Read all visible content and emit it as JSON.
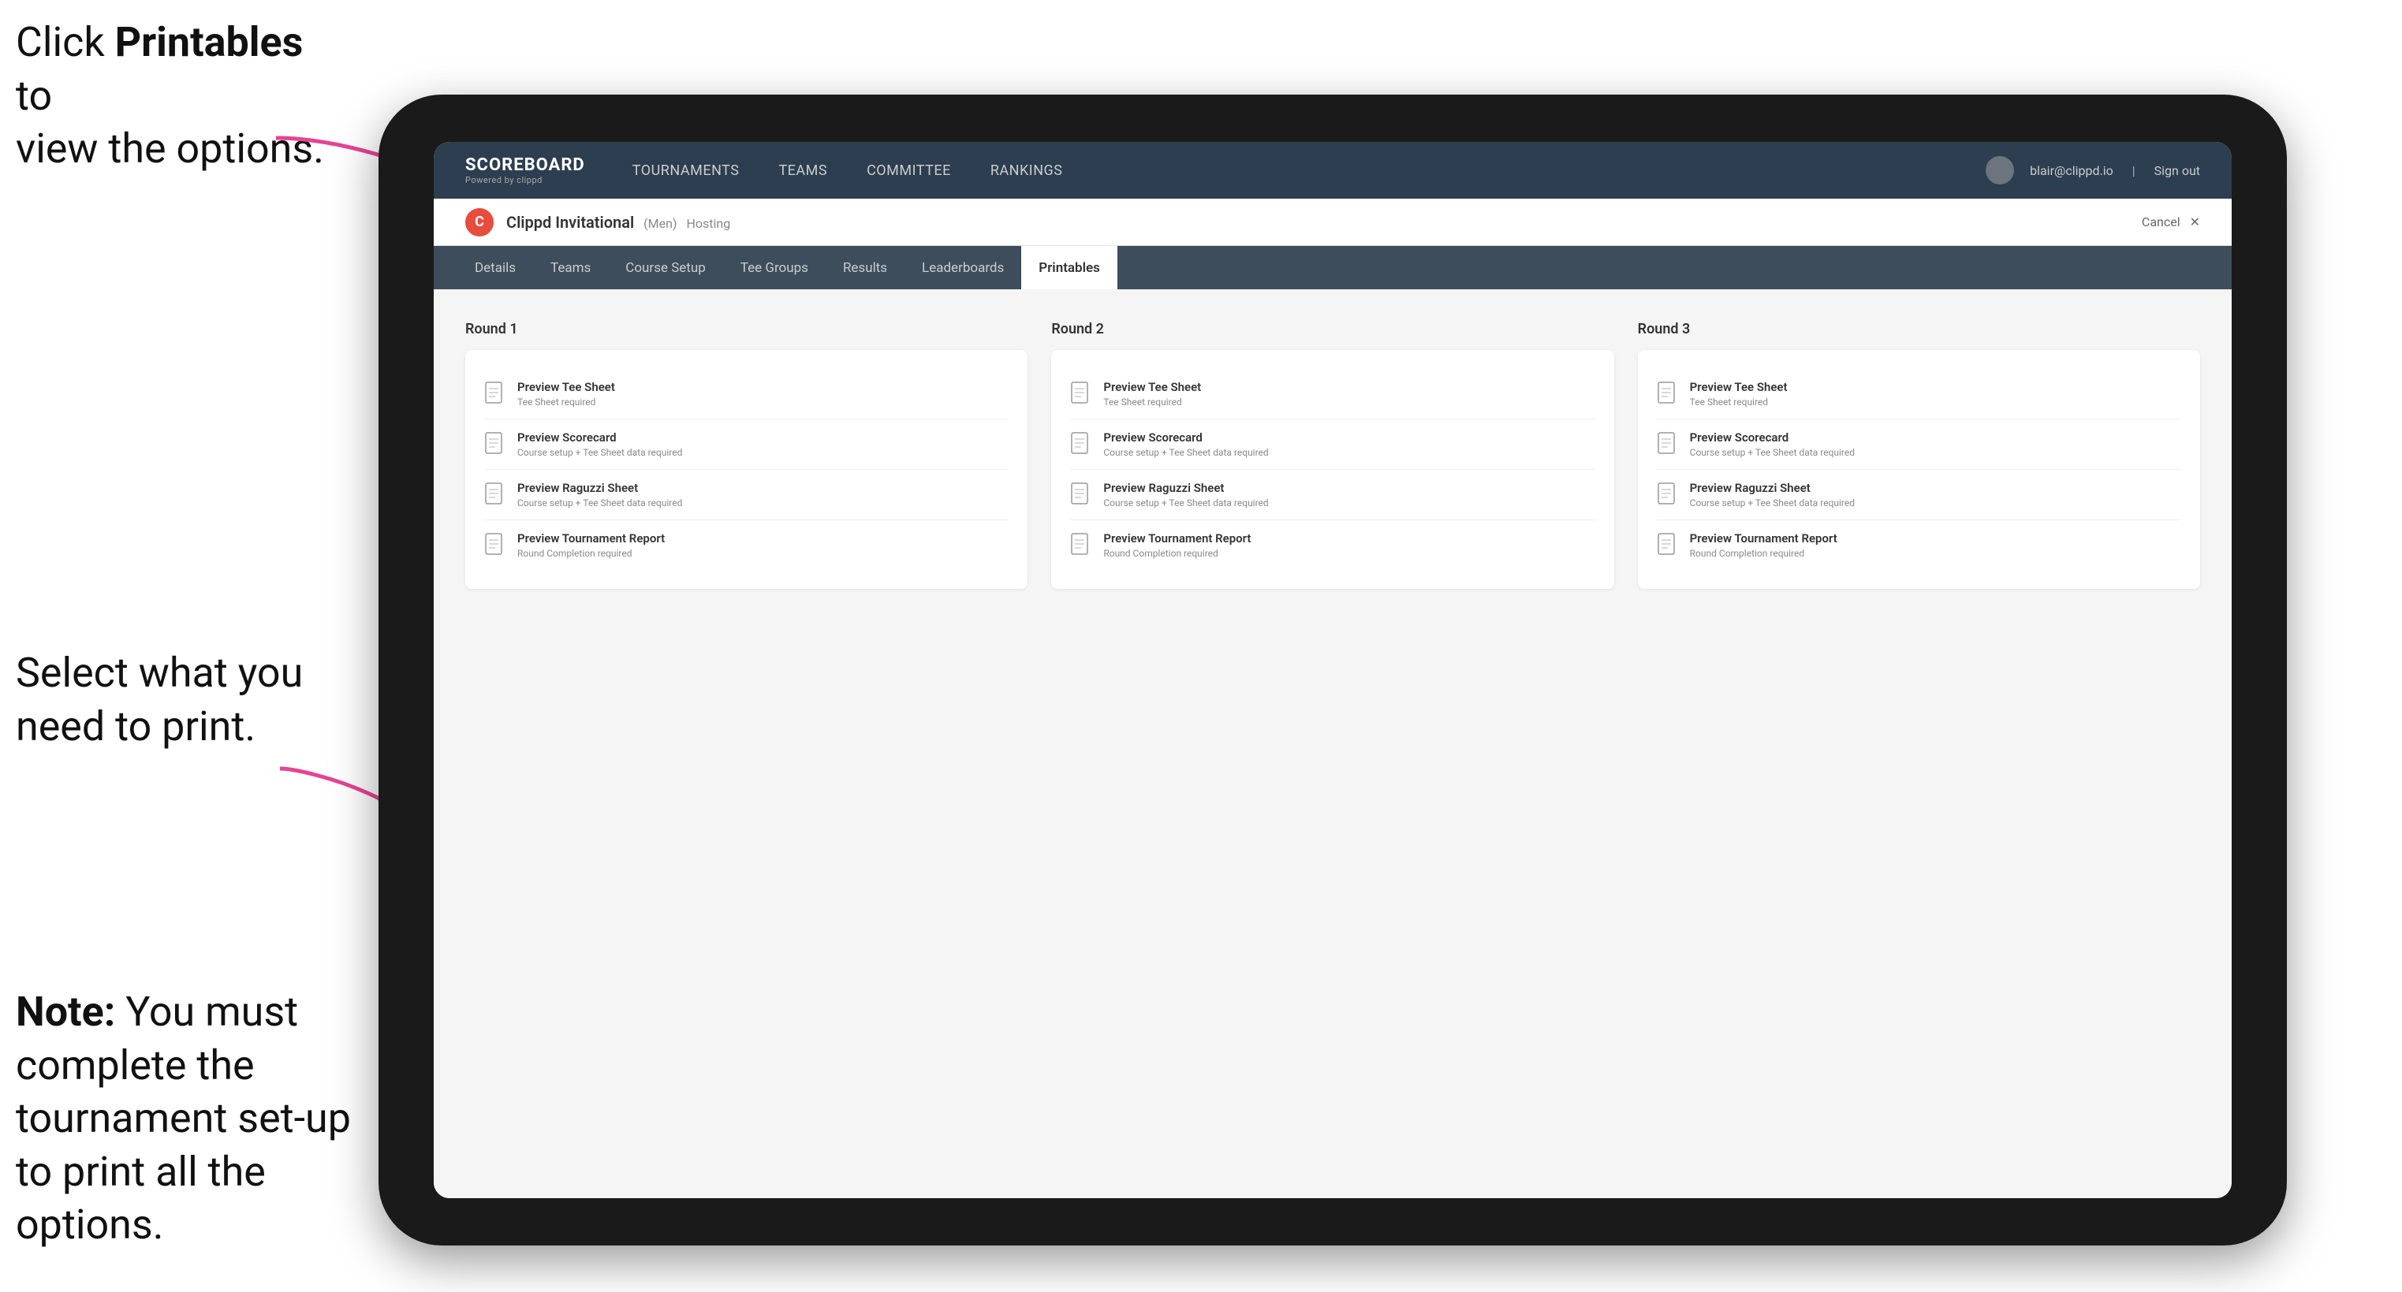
{
  "annotations": {
    "top": {
      "prefix": "Click ",
      "bold": "Printables",
      "suffix": " to\nview the options."
    },
    "middle": "Select what you\nneed to print.",
    "bottom": {
      "bold_prefix": "Note:",
      "suffix": " You must\ncomplete the\ntournament set-up\nto print all the options."
    }
  },
  "nav": {
    "logo_title": "SCOREBOARD",
    "logo_subtitle": "Powered by clippd",
    "links": [
      {
        "label": "TOURNAMENTS",
        "active": false
      },
      {
        "label": "TEAMS",
        "active": false
      },
      {
        "label": "COMMITTEE",
        "active": false
      },
      {
        "label": "RANKINGS",
        "active": false
      }
    ],
    "user_email": "blair@clippd.io",
    "sign_out": "Sign out"
  },
  "sub_header": {
    "logo_letter": "C",
    "tournament_name": "Clippd Invitational",
    "tournament_meta": "(Men)",
    "hosting": "Hosting",
    "cancel": "Cancel"
  },
  "tabs": [
    {
      "label": "Details",
      "active": false
    },
    {
      "label": "Teams",
      "active": false
    },
    {
      "label": "Course Setup",
      "active": false
    },
    {
      "label": "Tee Groups",
      "active": false
    },
    {
      "label": "Results",
      "active": false
    },
    {
      "label": "Leaderboards",
      "active": false
    },
    {
      "label": "Printables",
      "active": true
    }
  ],
  "rounds": [
    {
      "title": "Round 1",
      "items": [
        {
          "title": "Preview Tee Sheet",
          "sub": "Tee Sheet required"
        },
        {
          "title": "Preview Scorecard",
          "sub": "Course setup + Tee Sheet data required"
        },
        {
          "title": "Preview Raguzzi Sheet",
          "sub": "Course setup + Tee Sheet data required"
        },
        {
          "title": "Preview Tournament Report",
          "sub": "Round Completion required"
        }
      ]
    },
    {
      "title": "Round 2",
      "items": [
        {
          "title": "Preview Tee Sheet",
          "sub": "Tee Sheet required"
        },
        {
          "title": "Preview Scorecard",
          "sub": "Course setup + Tee Sheet data required"
        },
        {
          "title": "Preview Raguzzi Sheet",
          "sub": "Course setup + Tee Sheet data required"
        },
        {
          "title": "Preview Tournament Report",
          "sub": "Round Completion required"
        }
      ]
    },
    {
      "title": "Round 3",
      "items": [
        {
          "title": "Preview Tee Sheet",
          "sub": "Tee Sheet required"
        },
        {
          "title": "Preview Scorecard",
          "sub": "Course setup + Tee Sheet data required"
        },
        {
          "title": "Preview Raguzzi Sheet",
          "sub": "Course setup + Tee Sheet data required"
        },
        {
          "title": "Preview Tournament Report",
          "sub": "Round Completion required"
        }
      ]
    }
  ]
}
